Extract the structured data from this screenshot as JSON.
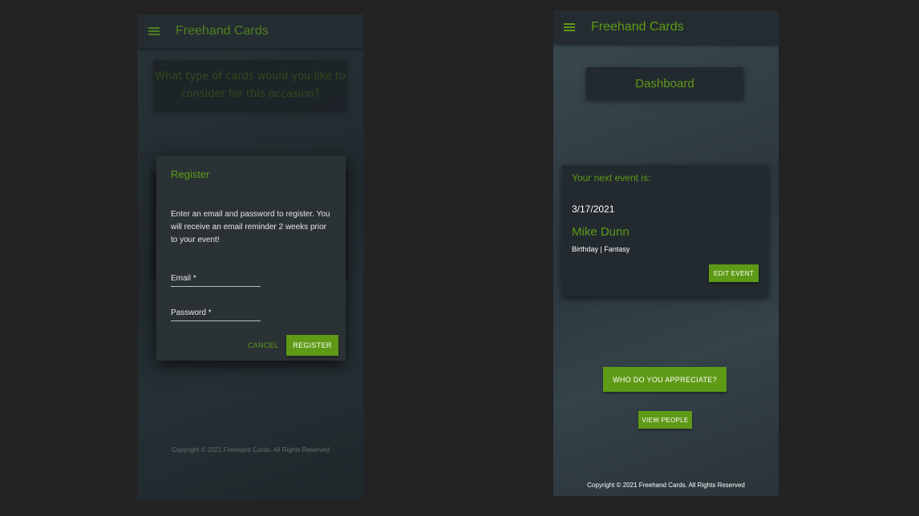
{
  "app": {
    "title": "Freehand Cards",
    "accent_color": "#5e9a16",
    "menu_icon": "hamburger-menu-icon"
  },
  "left_screen": {
    "question": "What type of cards would you like to consider for this occasion?",
    "register_dialog": {
      "title": "Register",
      "text": "Enter an email and password to register. You will receive an email reminder 2 weeks prior to your event!",
      "email_label": "Email *",
      "password_label": "Password *",
      "cancel_label": "CANCEL",
      "register_label": "REGISTER"
    },
    "footer": "Copyright © 2021 Freehand Cards. All Rights Reserved"
  },
  "right_screen": {
    "dashboard_label": "Dashboard",
    "event": {
      "heading": "Your next event is:",
      "date": "3/17/2021",
      "name": "Mike Dunn",
      "type": "Birthday | Fantasy",
      "edit_label": "EDIT EVENT"
    },
    "appreciate_label": "WHO DO YOU APPRECIATE?",
    "view_people_label": "VIEW PEOPLE",
    "footer": "Copyright © 2021 Freehand Cards. All Rights Reserved"
  }
}
